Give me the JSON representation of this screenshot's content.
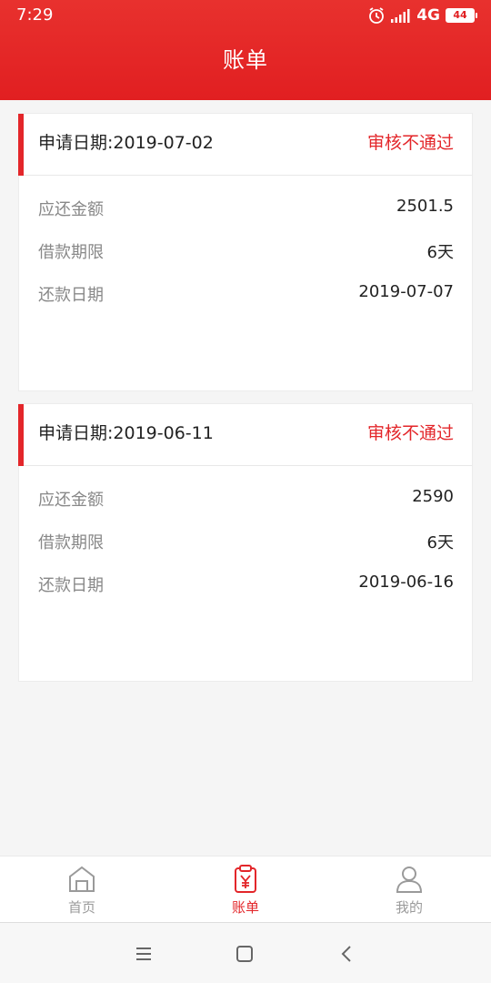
{
  "status_bar": {
    "time": "7:29",
    "network": "4G",
    "battery": "44",
    "icons": [
      "alarm-icon",
      "signal-icon",
      "battery-icon"
    ]
  },
  "header": {
    "title": "账单"
  },
  "bills": [
    {
      "apply_date": "申请日期:2019-07-02",
      "status": "审核不通过",
      "rows": [
        {
          "label": "应还金额",
          "value": "2501.5"
        },
        {
          "label": "借款期限",
          "value": "6天"
        },
        {
          "label": "还款日期",
          "value": "2019-07-07"
        }
      ]
    },
    {
      "apply_date": "申请日期:2019-06-11",
      "status": "审核不通过",
      "rows": [
        {
          "label": "应还金额",
          "value": "2590"
        },
        {
          "label": "借款期限",
          "value": "6天"
        },
        {
          "label": "还款日期",
          "value": "2019-06-16"
        }
      ]
    }
  ],
  "tabbar": {
    "items": [
      {
        "label": "首页",
        "icon": "home-icon",
        "active": false
      },
      {
        "label": "账单",
        "icon": "bill-icon",
        "active": true
      },
      {
        "label": "我的",
        "icon": "user-icon",
        "active": false
      }
    ]
  },
  "colors": {
    "brand": "#e3262a",
    "muted": "#9a9a9a"
  }
}
